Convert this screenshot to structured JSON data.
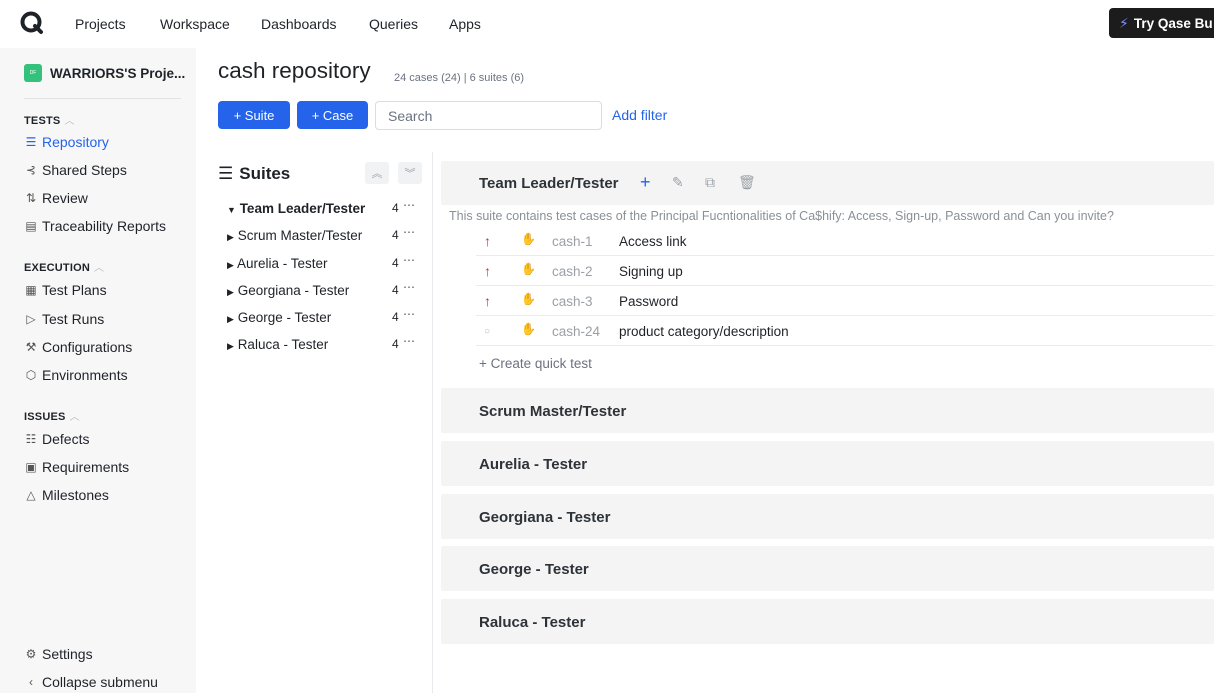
{
  "nav": {
    "items": [
      "Projects",
      "Workspace",
      "Dashboards",
      "Queries",
      "Apps"
    ],
    "try_label": "Try Qase Bu"
  },
  "sidebar": {
    "project": "WARRIORS'S Proje...",
    "project_badge": "DF",
    "tests_label": "TESTS",
    "tests": [
      "Repository",
      "Shared Steps",
      "Review",
      "Traceability Reports"
    ],
    "execution_label": "EXECUTION",
    "execution": [
      "Test Plans",
      "Test Runs",
      "Configurations",
      "Environments"
    ],
    "issues_label": "ISSUES",
    "issues": [
      "Defects",
      "Requirements",
      "Milestones"
    ],
    "settings": "Settings",
    "collapse": "Collapse submenu"
  },
  "header": {
    "title": "cash repository",
    "meta": "24 cases (24) | 6 suites (6)",
    "suite_btn": "+ Suite",
    "case_btn": "+ Case",
    "search_placeholder": "Search",
    "add_filter": "Add filter"
  },
  "suites_panel": {
    "heading": "Suites",
    "items": [
      {
        "name": "Team Leader/Tester",
        "count": "4",
        "expanded": true
      },
      {
        "name": "Scrum Master/Tester",
        "count": "4"
      },
      {
        "name": "Aurelia - Tester",
        "count": "4"
      },
      {
        "name": "Georgiana - Tester",
        "count": "4"
      },
      {
        "name": "George - Tester",
        "count": "4"
      },
      {
        "name": "Raluca - Tester",
        "count": "4"
      }
    ]
  },
  "main": {
    "open_suite": {
      "title": "Team Leader/Tester",
      "description": "This suite contains test cases of the Principal Fucntionalities of Ca$hify: Access, Sign-up, Password and Can you invite?",
      "cases": [
        {
          "id": "cash-1",
          "title": "Access link",
          "priority": "high"
        },
        {
          "id": "cash-2",
          "title": "Signing up",
          "priority": "high"
        },
        {
          "id": "cash-3",
          "title": "Password",
          "priority": "high"
        },
        {
          "id": "cash-24",
          "title": "product category/description",
          "priority": "none"
        }
      ],
      "quick_test": "+ Create quick test"
    },
    "collapsed_suites": [
      "Scrum Master/Tester",
      "Aurelia - Tester",
      "Georgiana - Tester",
      "George - Tester",
      "Raluca - Tester"
    ]
  },
  "colors": {
    "accent": "#2563eb",
    "high_priority": "#d92d20",
    "sidebar_bg": "#f7f7f8"
  }
}
